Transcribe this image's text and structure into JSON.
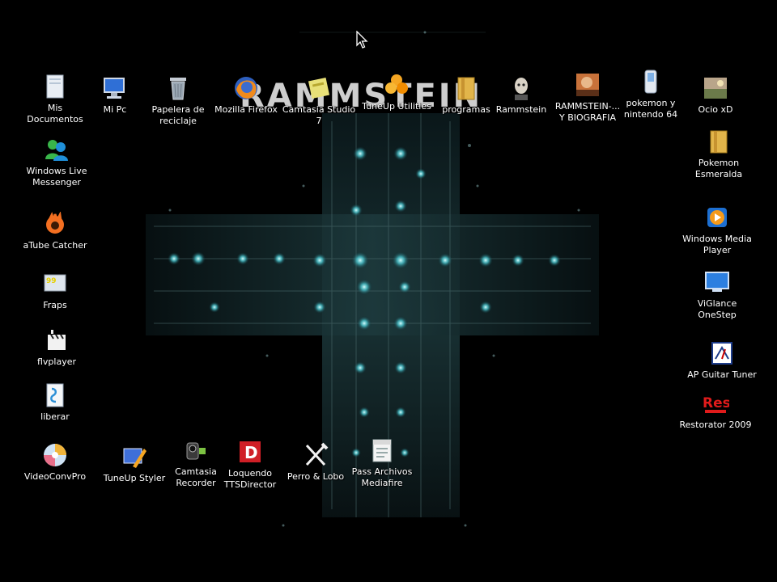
{
  "desktop": {
    "banner_text": "RAMMSTEIN",
    "icons": [
      {
        "id": "mis-documentos",
        "label": "Mis\nDocumentos",
        "icon": "documents-icon"
      },
      {
        "id": "mi-pc",
        "label": "Mi Pc",
        "icon": "computer-icon"
      },
      {
        "id": "papelera",
        "label": "Papelera de\nreciclaje",
        "icon": "recycle-bin-icon"
      },
      {
        "id": "firefox",
        "label": "Mozilla Firefox",
        "icon": "firefox-icon"
      },
      {
        "id": "camtasia-studio",
        "label": "Camtasia Studio\n7",
        "icon": "camtasia-studio-icon"
      },
      {
        "id": "tuneup-utilities",
        "label": "TuneUp Utilities",
        "icon": "tuneup-utilities-icon"
      },
      {
        "id": "programas",
        "label": "programas",
        "icon": "folder-icon"
      },
      {
        "id": "rammstein",
        "label": "Rammstein",
        "icon": "rammstein-icon"
      },
      {
        "id": "rammstein-biografia",
        "label": "RAMMSTEIN-...\nY BIOGRAFIA",
        "icon": "image-icon"
      },
      {
        "id": "pokemon-n64",
        "label": "pokemon y\nnintendo 64",
        "icon": "device-icon"
      },
      {
        "id": "ocio",
        "label": "Ocio xD",
        "icon": "image-icon"
      },
      {
        "id": "wlm",
        "label": "Windows Live\nMessenger",
        "icon": "messenger-icon"
      },
      {
        "id": "pokemon-esmeralda",
        "label": "Pokemon\nEsmeralda",
        "icon": "folder-icon"
      },
      {
        "id": "atube",
        "label": "aTube Catcher",
        "icon": "atube-catcher-icon"
      },
      {
        "id": "wmp",
        "label": "Windows Media\nPlayer",
        "icon": "media-player-icon"
      },
      {
        "id": "fraps",
        "label": "Fraps",
        "icon": "fraps-icon"
      },
      {
        "id": "viglance",
        "label": "ViGlance\nOneStep",
        "icon": "monitor-icon"
      },
      {
        "id": "flvplayer",
        "label": "flvplayer",
        "icon": "clapperboard-icon"
      },
      {
        "id": "ap-guitar",
        "label": "AP Guitar Tuner",
        "icon": "tuner-icon"
      },
      {
        "id": "liberar",
        "label": "liberar",
        "icon": "script-icon"
      },
      {
        "id": "restorator",
        "label": "Restorator 2009",
        "icon": "restorator-icon"
      },
      {
        "id": "videoconv",
        "label": "VideoConvPro",
        "icon": "disc-icon"
      },
      {
        "id": "tuneup-styler",
        "label": "TuneUp Styler",
        "icon": "styler-icon"
      },
      {
        "id": "camtasia-recorder",
        "label": "Camtasia\nRecorder",
        "icon": "camera-icon"
      },
      {
        "id": "loquendo",
        "label": "Loquendo\nTTSDirector",
        "icon": "loquendo-icon"
      },
      {
        "id": "perro-lobo",
        "label": "Perro & Lobo",
        "icon": "fork-knife-icon"
      },
      {
        "id": "pass-archivos",
        "label": "Pass Archivos\nMediafire",
        "icon": "text-file-icon"
      }
    ]
  }
}
